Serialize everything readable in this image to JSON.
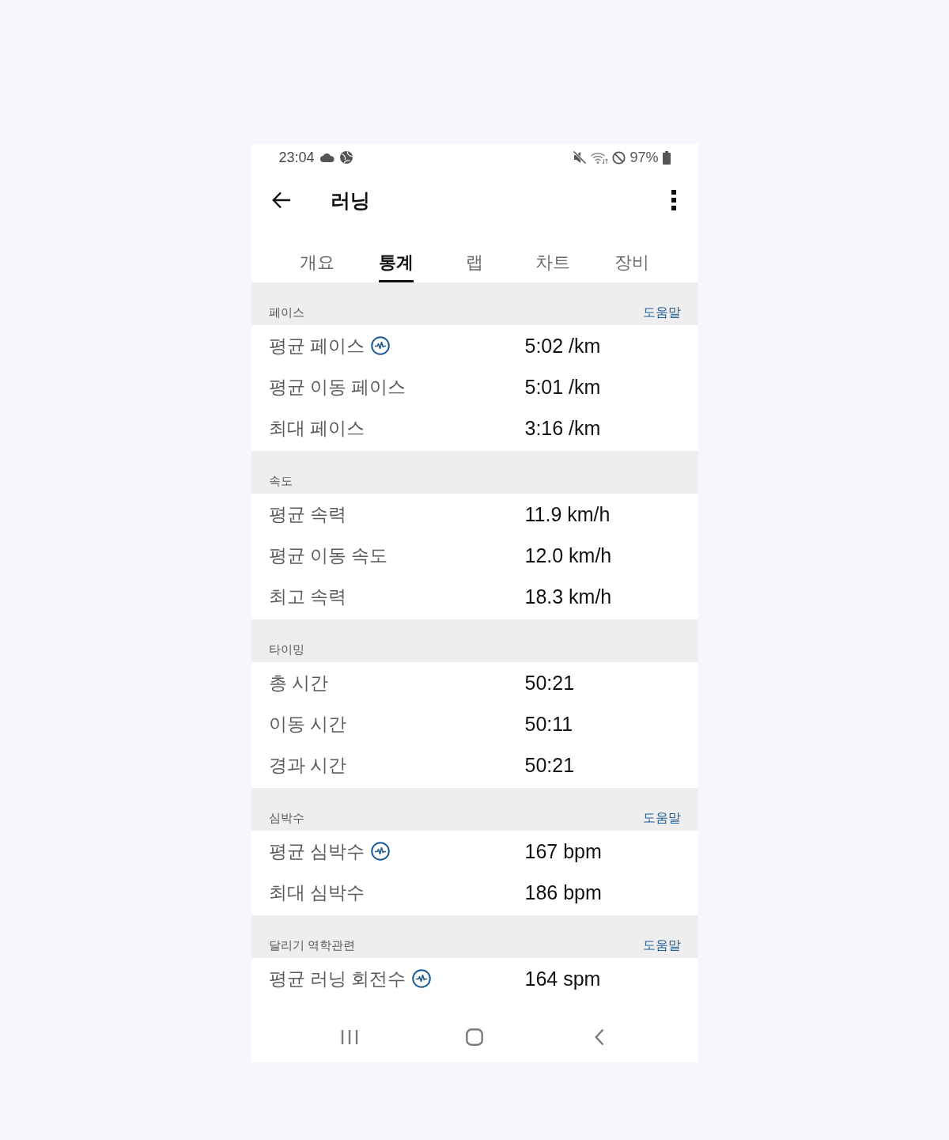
{
  "status_bar": {
    "time": "23:04",
    "battery": "97%"
  },
  "app_bar": {
    "title": "러닝"
  },
  "tabs": [
    {
      "label": "개요",
      "selected": false
    },
    {
      "label": "통계",
      "selected": true
    },
    {
      "label": "랩",
      "selected": false
    },
    {
      "label": "차트",
      "selected": false
    },
    {
      "label": "장비",
      "selected": false
    }
  ],
  "sections": [
    {
      "title": "페이스",
      "help_link": "도움말",
      "rows": [
        {
          "label": "평균 페이스",
          "badge": true,
          "value": "5:02 /km"
        },
        {
          "label": "평균 이동 페이스",
          "badge": false,
          "value": "5:01 /km"
        },
        {
          "label": "최대 페이스",
          "badge": false,
          "value": "3:16 /km"
        }
      ]
    },
    {
      "title": "속도",
      "rows": [
        {
          "label": "평균 속력",
          "badge": false,
          "value": "11.9 km/h"
        },
        {
          "label": "평균 이동 속도",
          "badge": false,
          "value": "12.0 km/h"
        },
        {
          "label": "최고 속력",
          "badge": false,
          "value": "18.3 km/h"
        }
      ]
    },
    {
      "title": "타이밍",
      "rows": [
        {
          "label": "총 시간",
          "badge": false,
          "value": "50:21"
        },
        {
          "label": "이동 시간",
          "badge": false,
          "value": "50:11"
        },
        {
          "label": "경과 시간",
          "badge": false,
          "value": "50:21"
        }
      ]
    },
    {
      "title": "심박수",
      "help_link": "도움말",
      "rows": [
        {
          "label": "평균 심박수",
          "badge": true,
          "value": "167 bpm"
        },
        {
          "label": "최대 심박수",
          "badge": false,
          "value": "186 bpm"
        }
      ]
    },
    {
      "title": "달리기 역학관련",
      "help_link": "도움말",
      "rows": [
        {
          "label": "평균 러닝 회전수",
          "badge": true,
          "value": "164 spm"
        }
      ]
    }
  ]
}
